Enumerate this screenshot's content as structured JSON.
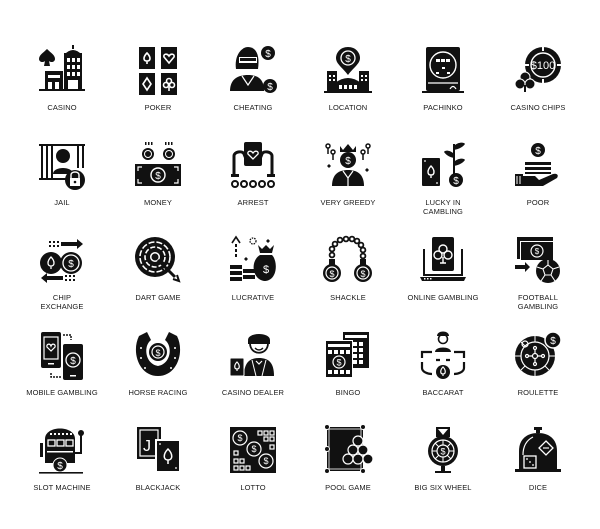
{
  "icon_set": {
    "color": "#111111",
    "background": "#ffffff",
    "rows": [
      [
        {
          "label": "CASINO",
          "icon": "casino-building-icon"
        },
        {
          "label": "POKER",
          "icon": "poker-cards-icon"
        },
        {
          "label": "CHEATING",
          "icon": "cheating-woman-icon"
        },
        {
          "label": "LOCATION",
          "icon": "casino-location-icon"
        },
        {
          "label": "PACHINKO",
          "icon": "pachinko-machine-icon"
        },
        {
          "label": "CASINO CHIPS",
          "icon": "casino-chip-icon",
          "chip_value": "$100"
        }
      ],
      [
        {
          "label": "JAIL",
          "icon": "jail-icon"
        },
        {
          "label": "MONEY",
          "icon": "money-icon"
        },
        {
          "label": "ARREST",
          "icon": "arrest-handcuffs-icon"
        },
        {
          "label": "VERY GREEDY",
          "icon": "greedy-king-icon"
        },
        {
          "label": "LUCKY IN CAMBLING",
          "icon": "lucky-plant-card-icon"
        },
        {
          "label": "POOR",
          "icon": "poor-hand-coin-icon"
        }
      ],
      [
        {
          "label": "CHIP EXCHANGE",
          "icon": "chip-exchange-icon"
        },
        {
          "label": "DART GAME",
          "icon": "dart-target-icon"
        },
        {
          "label": "LUCRATIVE",
          "icon": "lucrative-money-bag-icon"
        },
        {
          "label": "SHACKLE",
          "icon": "shackle-icon"
        },
        {
          "label": "ONLINE GAMBLING",
          "icon": "online-gambling-laptop-icon"
        },
        {
          "label": "FOOTBALL GAMBLING",
          "icon": "football-gambling-icon"
        }
      ],
      [
        {
          "label": "MOBILE GAMBLING",
          "icon": "mobile-gambling-icon"
        },
        {
          "label": "HORSE RACING",
          "icon": "horseshoe-icon"
        },
        {
          "label": "CASINO DEALER",
          "icon": "casino-dealer-icon"
        },
        {
          "label": "BINGO",
          "icon": "bingo-card-icon"
        },
        {
          "label": "BACCARAT",
          "icon": "baccarat-table-icon"
        },
        {
          "label": "ROULETTE",
          "icon": "roulette-wheel-icon"
        }
      ],
      [
        {
          "label": "SLOT MACHINE",
          "icon": "slot-machine-icon"
        },
        {
          "label": "BLACKJACK",
          "icon": "blackjack-cards-icon",
          "card_letter": "J"
        },
        {
          "label": "LOTTO",
          "icon": "lotto-ticket-icon"
        },
        {
          "label": "POOL GAME",
          "icon": "pool-table-icon"
        },
        {
          "label": "BIG SIX WHEEL",
          "icon": "big-six-wheel-icon"
        },
        {
          "label": "DICE",
          "icon": "dice-dome-icon"
        }
      ]
    ]
  }
}
